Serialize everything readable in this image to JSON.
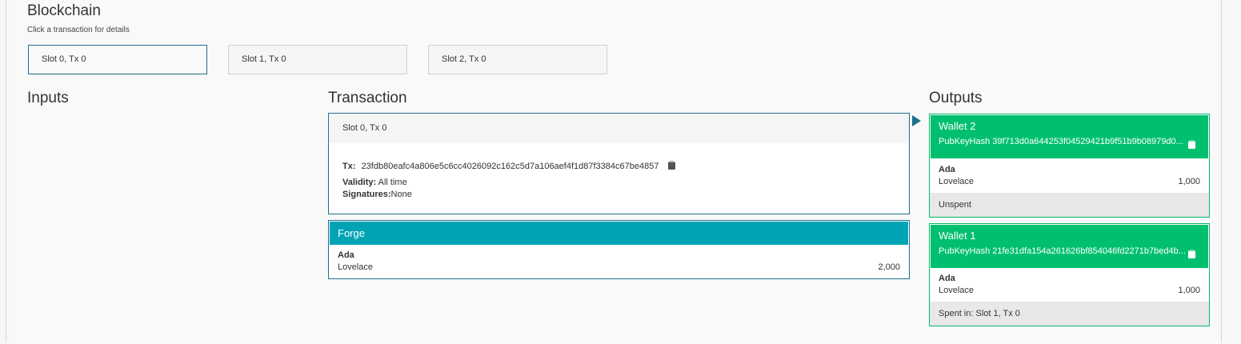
{
  "page": {
    "title": "Blockchain",
    "subtitle": "Click a transaction for details"
  },
  "slots": [
    {
      "label": "Slot 0, Tx 0",
      "active": true
    },
    {
      "label": "Slot 1, Tx 0",
      "active": false
    },
    {
      "label": "Slot 2, Tx 0",
      "active": false
    }
  ],
  "sections": {
    "inputs": "Inputs",
    "transaction": "Transaction",
    "outputs": "Outputs"
  },
  "transaction": {
    "header": "Slot 0, Tx 0",
    "tx_label": "Tx:",
    "tx_hash": "23fdb80eafc4a806e5c6cc4026092c162c5d7a106aef4f1d87f3384c67be4857",
    "validity_label": "Validity:",
    "validity_value": "All time",
    "signatures_label": "Signatures:",
    "signatures_value": "None"
  },
  "forge": {
    "header": "Forge",
    "currency": "Ada",
    "token": "Lovelace",
    "amount": "2,000"
  },
  "outputs": [
    {
      "wallet": "Wallet 2",
      "pubkey": "PubKeyHash 39f713d0a644253f04529421b9f51b9b08979d0...",
      "currency": "Ada",
      "token": "Lovelace",
      "amount": "1,000",
      "status": "Unspent"
    },
    {
      "wallet": "Wallet 1",
      "pubkey": "PubKeyHash 21fe31dfa154a261626bf854046fd2271b7bed4b...",
      "currency": "Ada",
      "token": "Lovelace",
      "amount": "1,000",
      "status": "Spent in: Slot 1, Tx 0"
    }
  ],
  "colors": {
    "accent": "#1f6f8b",
    "forge": "#00a3b4",
    "wallet": "#00c06f",
    "footer": "#e8e8e8"
  },
  "icons": {
    "copy": "clipboard-icon",
    "flow": "triangle-right-icon"
  }
}
